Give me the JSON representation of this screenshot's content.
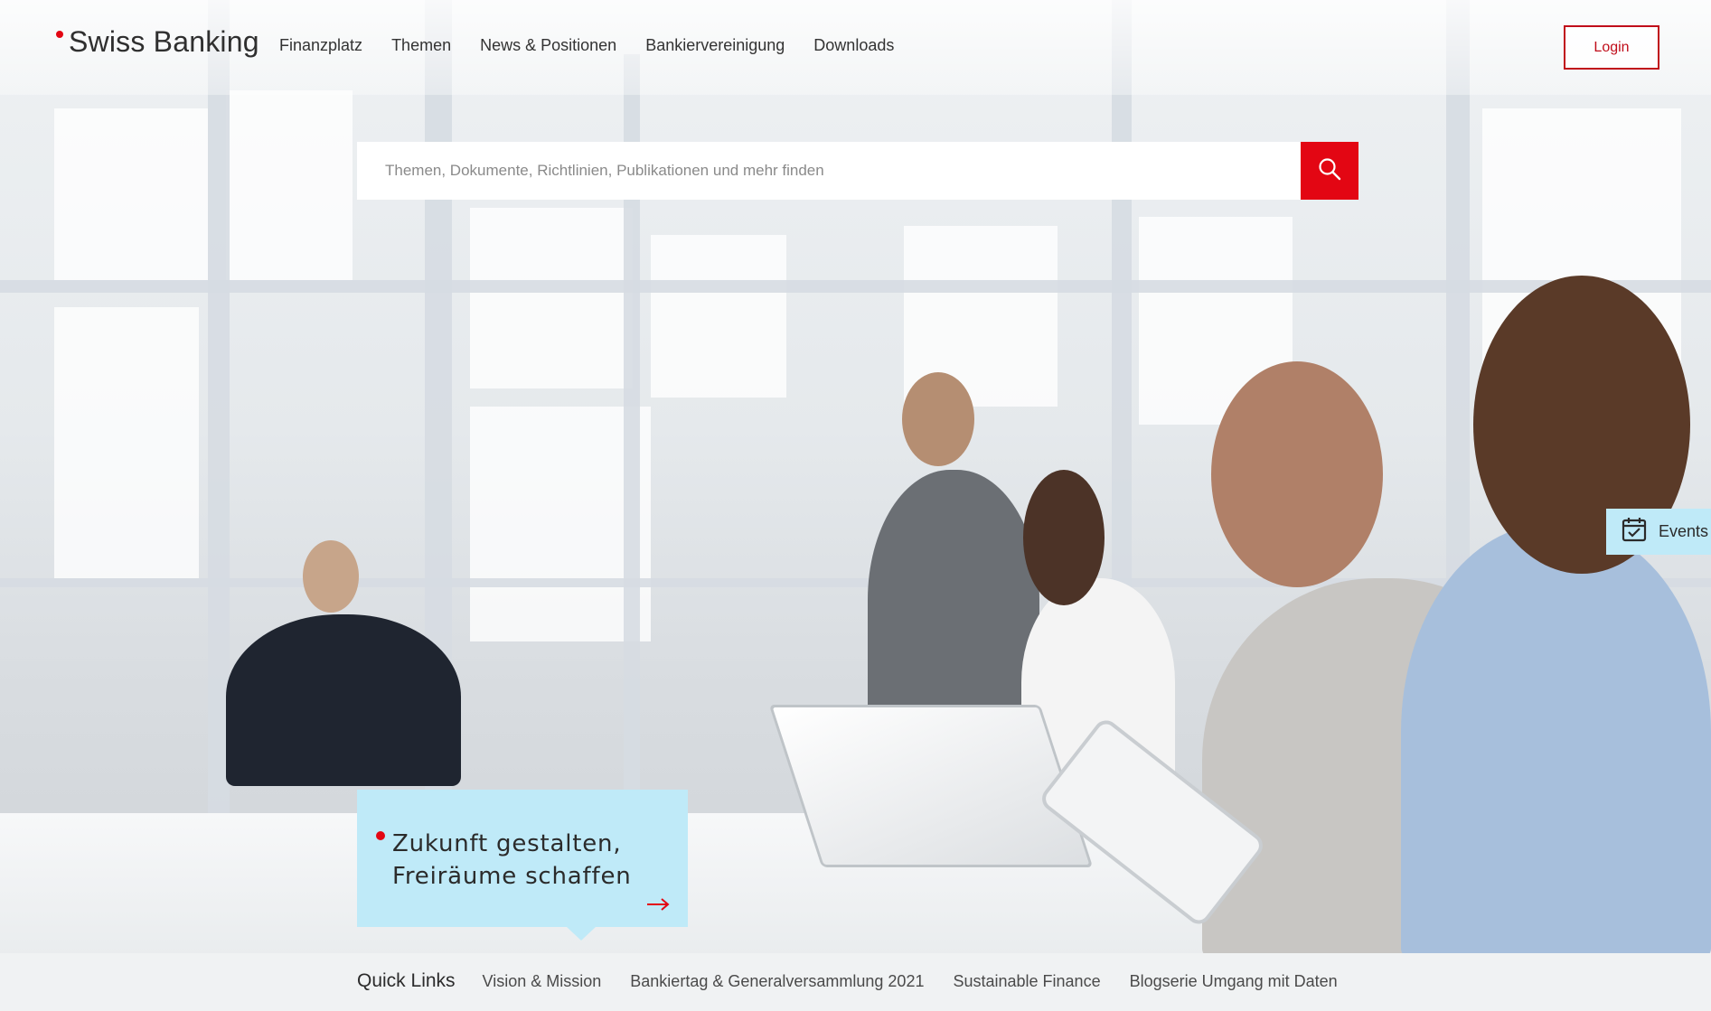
{
  "header": {
    "logo_text": "Swiss Banking",
    "nav": [
      {
        "label": "Finanzplatz"
      },
      {
        "label": "Themen"
      },
      {
        "label": "News & Positionen"
      },
      {
        "label": "Bankiervereinigung"
      },
      {
        "label": "Downloads"
      }
    ],
    "login_label": "Login"
  },
  "search": {
    "placeholder": "Themen, Dokumente, Richtlinien, Publikationen und mehr finden",
    "icon": "search-icon"
  },
  "events_tab": {
    "label": "Events",
    "icon": "calendar-check-icon"
  },
  "teaser": {
    "title_line1": "Zukunft gestalten,",
    "title_line2": "Freiräume schaffen",
    "icon": "arrow-right-icon"
  },
  "quick_links": {
    "heading": "Quick Links",
    "links": [
      {
        "label": "Vision & Mission"
      },
      {
        "label": "Bankiertag & Generalversammlung 2021"
      },
      {
        "label": "Sustainable Finance"
      },
      {
        "label": "Blogserie Umgang mit Daten"
      }
    ]
  },
  "colors": {
    "accent_red": "#e30613",
    "teaser_blue": "#bfeaf8"
  }
}
